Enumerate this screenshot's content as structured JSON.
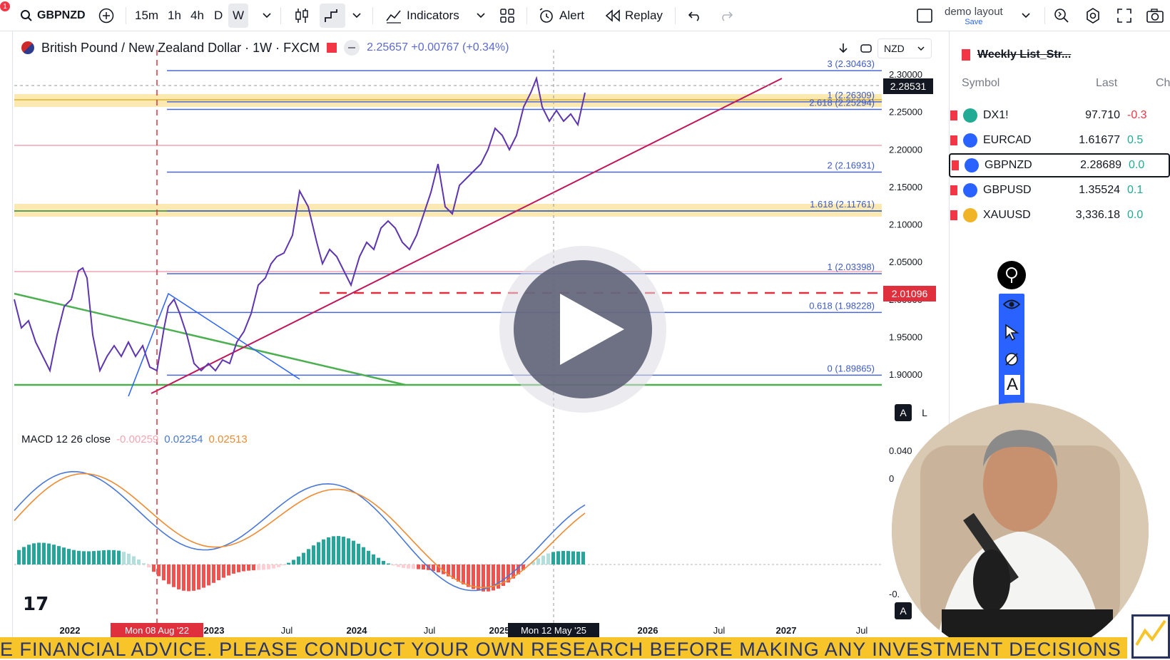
{
  "toolbar": {
    "notification_count": "1",
    "symbol": "GBPNZD",
    "intervals": [
      "15m",
      "1h",
      "4h",
      "D",
      "W"
    ],
    "active_interval": "W",
    "indicators_label": "Indicators",
    "alert_label": "Alert",
    "replay_label": "Replay",
    "layout_name": "demo layout",
    "layout_save": "Save"
  },
  "legend": {
    "title": "British Pound / New Zealand Dollar · 1W · FXCM",
    "price_change": "2.25657 +0.00767 (+0.34%)",
    "currency": "NZD"
  },
  "price_axis": {
    "ticks": [
      "2.30000",
      "2.25000",
      "2.20000",
      "2.15000",
      "2.10000",
      "2.05000",
      "2.00000",
      "1.95000",
      "1.90000"
    ],
    "current_price": "2.28531",
    "dashed_level": "2.01096"
  },
  "fib_labels": [
    "3 (2.30463)",
    "1 (2.26309)",
    "2.618 (2.25294)",
    "2 (2.16931)",
    "1.618 (2.11761)",
    "1 (2.03398)",
    "0.618 (1.98228)",
    "0 (1.89865)"
  ],
  "macd": {
    "label": "MACD 12 26 close",
    "v1": "-0.00259",
    "v2": "0.02254",
    "v3": "0.02513",
    "axis_ticks": [
      "0.040",
      "0",
      "-0."
    ]
  },
  "time_axis": {
    "labels": [
      "2022",
      "2023",
      "Jul",
      "2024",
      "Jul",
      "2025",
      "2026",
      "Jul",
      "2027",
      "Jul"
    ],
    "cursor_left": "Mon 08 Aug '22",
    "cursor_right": "Mon 12 May '25"
  },
  "scale_buttons": [
    "A",
    "L"
  ],
  "watchlist": {
    "title": "Weekly List_Str...",
    "headers": [
      "Symbol",
      "Last",
      "Ch"
    ],
    "rows": [
      {
        "symbol": "DX1!",
        "last": "97.710",
        "change": "-0.3",
        "icon_color": "#22ab94",
        "change_color": "#f23645"
      },
      {
        "symbol": "EURCAD",
        "last": "1.61677",
        "change": "0.5",
        "icon_color": "#2962ff",
        "change_color": "#22ab94"
      },
      {
        "symbol": "GBPNZD",
        "last": "2.28689",
        "change": "0.0",
        "icon_color": "#2962ff",
        "change_color": "#22ab94"
      },
      {
        "symbol": "GBPUSD",
        "last": "1.35524",
        "change": "0.1",
        "icon_color": "#2962ff",
        "change_color": "#22ab94"
      },
      {
        "symbol": "XAUUSD",
        "last": "3,336.18",
        "change": "0.0",
        "icon_color": "#f0b429",
        "change_color": "#22ab94"
      }
    ]
  },
  "ticker_text": "E FINANCIAL ADVICE. PLEASE CONDUCT YOUR OWN RESEARCH BEFORE MAKING ANY INVESTMENT DECISIONS"
}
